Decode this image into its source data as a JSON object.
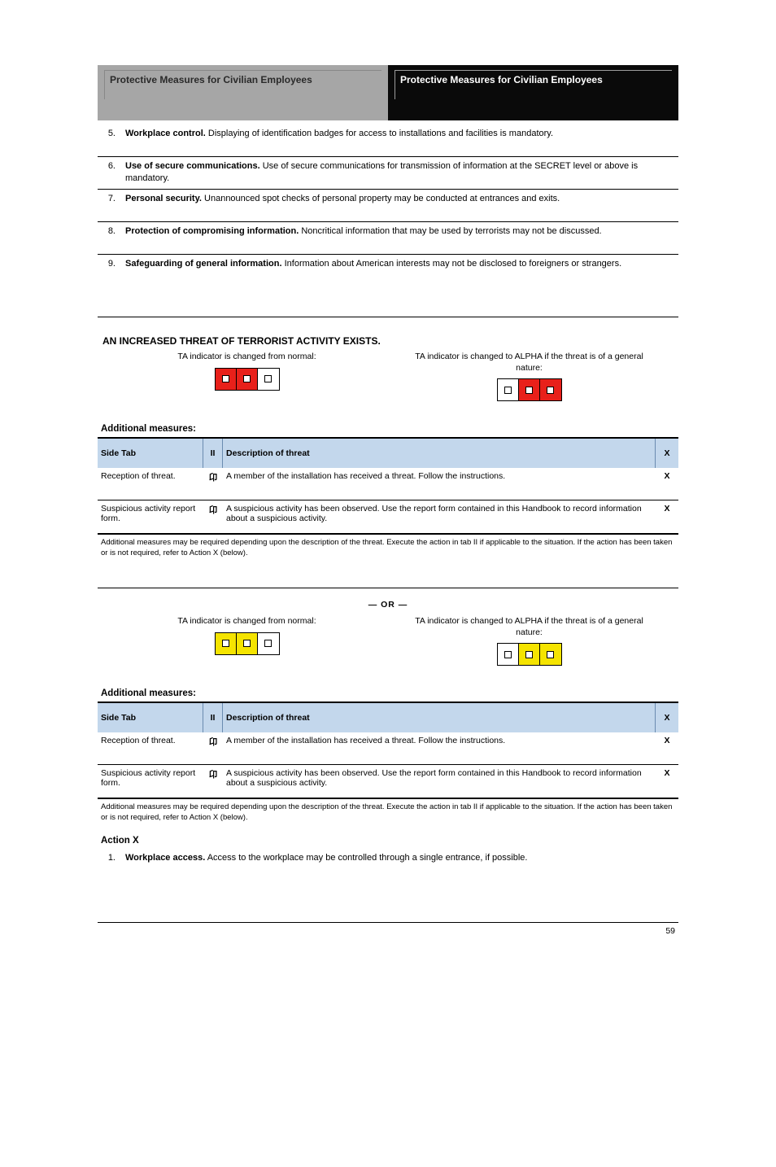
{
  "tabs": {
    "left": "Protective Measures for Civilian Employees",
    "right": "Protective Measures for Civilian Employees"
  },
  "rules": [
    {
      "n": "5.",
      "label": "Workplace control.",
      "body": "Displaying of identification badges for access to installations and facilities is mandatory."
    },
    {
      "n": "6.",
      "label": "Use of secure communications.",
      "body": "Use of secure communications for transmission of information at the SECRET level or above is mandatory."
    },
    {
      "n": "7.",
      "label": "Personal security.",
      "body": "Unannounced spot checks of personal property may be conducted at entrances and exits."
    },
    {
      "n": "8.",
      "label": "Protection of compromising information.",
      "body": "Noncritical information that may be used by terrorists may not be discussed."
    },
    {
      "n": "9.",
      "label": "Safeguarding of general information.",
      "body": "Information about American interests may not be disclosed to foreigners or strangers."
    }
  ],
  "section_a": {
    "heading": "AN INCREASED THREAT OF TERRORIST ACTIVITY EXISTS.",
    "left_caption": "TA indicator is changed from normal:",
    "right_caption": "TA indicator is changed to ALPHA if the threat is of a general nature:",
    "subhead": "Additional measures:",
    "table": {
      "columns": {
        "side": "Side Tab",
        "ii": "II",
        "threat": "Description of threat",
        "act": "X"
      },
      "rows": [
        {
          "side": "Reception of threat.",
          "ii": "卬",
          "threat": "A member of the installation has received a threat. Follow the instructions.",
          "act": "X"
        },
        {
          "side": "Suspicious activity report form.",
          "ii": "卬",
          "threat": "A suspicious activity has been observed. Use the report form contained in this Handbook to record information about a suspicious activity.",
          "act": "X"
        }
      ],
      "footnote": "Additional measures may be required depending upon the description of the threat. Execute the action in tab II if applicable to the situation. If the action has been taken or is not required, refer to Action X (below)."
    }
  },
  "or_text": "— OR —",
  "section_b": {
    "subhead": "Additional measures:",
    "table": {
      "columns": {
        "side": "Side Tab",
        "ii": "II",
        "threat": "Description of threat",
        "act": "X"
      },
      "rows": [
        {
          "side": "Reception of threat.",
          "ii": "卬",
          "threat": "A member of the installation has received a threat. Follow the instructions.",
          "act": "X"
        },
        {
          "side": "Suspicious activity report form.",
          "ii": "卬",
          "threat": "A suspicious activity has been observed. Use the report form contained in this Handbook to record information about a suspicious activity.",
          "act": "X"
        }
      ],
      "footnote": "Additional measures may be required depending upon the description of the threat. Execute the action in tab II if applicable to the situation. If the action has been taken or is not required, refer to Action X (below)."
    },
    "action_x_head": "Action X",
    "action_x_1": {
      "n": "1.",
      "label": "Workplace access.",
      "body": "Access to the workplace may be controlled through a single entrance, if possible."
    }
  },
  "page_number": "59"
}
